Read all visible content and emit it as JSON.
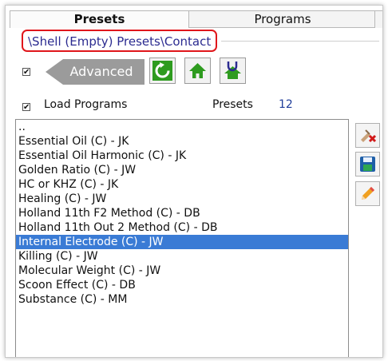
{
  "tabs": [
    {
      "label": "Presets",
      "active": true
    },
    {
      "label": "Programs",
      "active": false
    }
  ],
  "path": "\\Shell (Empty) Presets\\Contact",
  "advanced": {
    "label": "Advanced",
    "checked": true
  },
  "toolbar_icons": [
    "refresh-icon",
    "home-icon",
    "user-home-icon"
  ],
  "load_programs": {
    "label": "Load Programs",
    "checked": true
  },
  "presets": {
    "label": "Presets",
    "count": "12"
  },
  "list": {
    "items": [
      "..",
      "Essential Oil (C) - JK",
      "Essential Oil Harmonic (C) - JK",
      "Golden Ratio (C) - JW",
      "HC or KHZ (C) - JK",
      "Healing (C) - JW",
      "Holland 11th F2 Method (C) - DB",
      "Holland 11th Out 2 Method (C) - DB",
      "Internal Electrode (C) - JW",
      "Killing (C) - JW",
      "Molecular Weight (C) - JW",
      "Scoon Effect (C) - DB",
      "Substance (C) - MM"
    ],
    "selected_index": 8
  },
  "side_icons": [
    "delete-icon",
    "save-icon",
    "edit-pencil-icon"
  ],
  "colors": {
    "selection": "#3a7bd5",
    "path_border": "#e0161b",
    "path_text": "#2b2b90",
    "count_text": "#1f3d9a",
    "toolbar_green": "#2e9b1f"
  }
}
